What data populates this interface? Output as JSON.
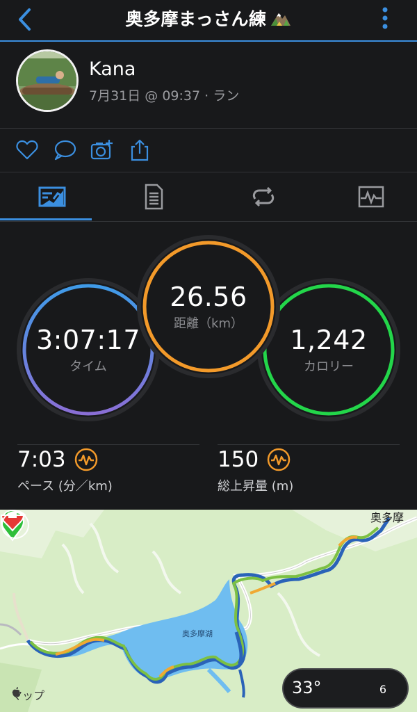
{
  "header": {
    "title": "奥多摩まっさん練"
  },
  "user": {
    "name": "Kana",
    "meta": "7月31日 @ 09:37 · ラン"
  },
  "stats": {
    "time": {
      "value": "3:07:17",
      "label": "タイム",
      "color": "#6e7be0"
    },
    "distance": {
      "value": "26.56",
      "label": "距離（km）",
      "color": "#f39a2a"
    },
    "calories": {
      "value": "1,242",
      "label": "カロリー",
      "color": "#23d64a"
    }
  },
  "metrics": [
    {
      "value": "7:03",
      "label": "ペース (分／km)"
    },
    {
      "value": "150",
      "label": "総上昇量 (m)"
    }
  ],
  "map": {
    "lake_label": "奥多摩湖",
    "town_label": "奥多摩",
    "temperature": "33°",
    "aqi": "6",
    "attribution": "マップ"
  },
  "colors": {
    "accent": "#3b8fe0",
    "background": "#18191b",
    "metric_icon": "#f39a2a"
  }
}
